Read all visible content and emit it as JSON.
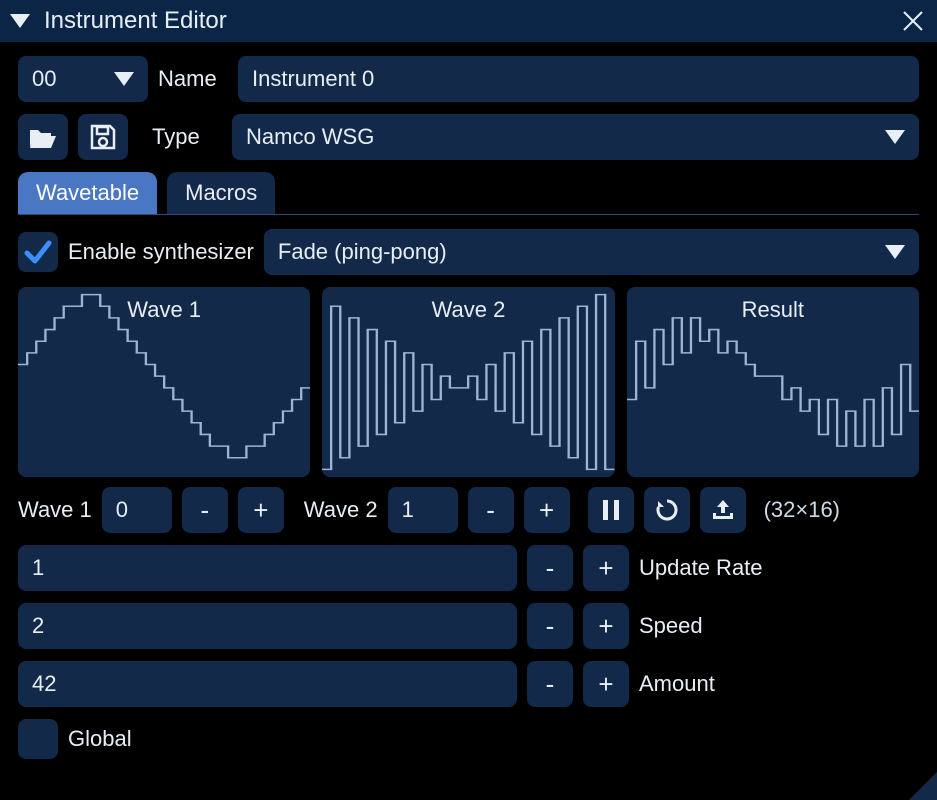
{
  "window": {
    "title": "Instrument Editor"
  },
  "header": {
    "instrument_number": "00",
    "name_label": "Name",
    "name_value": "Instrument 0",
    "type_label": "Type",
    "type_value": "Namco WSG"
  },
  "tabs": {
    "wavetable": "Wavetable",
    "macros": "Macros"
  },
  "synth": {
    "enable_label": "Enable synthesizer",
    "enabled": true,
    "mode": "Fade (ping-pong)"
  },
  "waves": {
    "wave1_title": "Wave 1",
    "wave2_title": "Wave 2",
    "result_title": "Result",
    "wave1_label": "Wave 1",
    "wave1_value": "0",
    "wave2_label": "Wave 2",
    "wave2_value": "1",
    "dims": "(32×16)"
  },
  "params": {
    "update_rate_value": "1",
    "update_rate_label": "Update Rate",
    "speed_value": "2",
    "speed_label": "Speed",
    "amount_value": "42",
    "amount_label": "Amount",
    "global_label": "Global"
  },
  "glyphs": {
    "minus": "-",
    "plus": "+"
  },
  "wave_data": {
    "wave1": [
      9,
      10,
      11,
      12,
      13,
      14,
      14,
      15,
      15,
      14,
      13,
      12,
      11,
      10,
      9,
      8,
      7,
      6,
      5,
      4,
      3,
      2,
      2,
      1,
      1,
      2,
      2,
      3,
      4,
      5,
      6,
      7
    ],
    "wave2": [
      0,
      14,
      1,
      13,
      2,
      12,
      3,
      11,
      4,
      10,
      5,
      9,
      6,
      8,
      7,
      7,
      8,
      6,
      9,
      5,
      10,
      4,
      11,
      3,
      12,
      2,
      13,
      1,
      14,
      0,
      15,
      0
    ],
    "result": [
      6,
      11,
      7,
      12,
      9,
      13,
      10,
      13,
      11,
      12,
      10,
      11,
      10,
      9,
      8,
      8,
      8,
      6,
      7,
      5,
      6,
      3,
      6,
      2,
      5,
      2,
      6,
      2,
      7,
      3,
      9,
      5
    ]
  }
}
